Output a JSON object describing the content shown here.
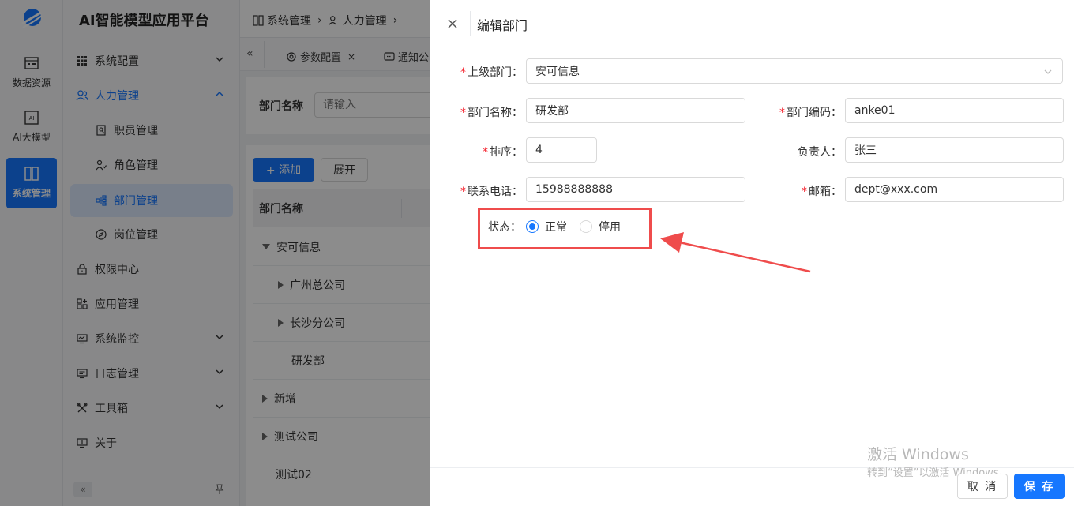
{
  "rail": {
    "items": [
      {
        "label": "数据资源"
      },
      {
        "label": "AI大模型"
      },
      {
        "label": "系统管理"
      }
    ]
  },
  "side": {
    "app_title": "AI智能模型应用平台",
    "menu": [
      {
        "label": "系统配置"
      },
      {
        "label": "人力管理"
      },
      {
        "label": "职员管理"
      },
      {
        "label": "角色管理"
      },
      {
        "label": "部门管理"
      },
      {
        "label": "岗位管理"
      },
      {
        "label": "权限中心"
      },
      {
        "label": "应用管理"
      },
      {
        "label": "系统监控"
      },
      {
        "label": "日志管理"
      },
      {
        "label": "工具箱"
      },
      {
        "label": "关于"
      }
    ]
  },
  "header": {
    "breadcrumb": [
      "系统管理",
      "人力管理"
    ]
  },
  "tabs": [
    "参数配置",
    "通知公"
  ],
  "behind": {
    "search_label": "部门名称",
    "search_placeholder": "请输入",
    "add_button": "+ 添加",
    "expand_button": "展开",
    "column_header": "部门名称",
    "rows": [
      "安可信息",
      "广州总公司",
      "长沙分公司",
      "研发部",
      "新增",
      "测试公司",
      "测试02"
    ]
  },
  "drawer": {
    "title": "编辑部门",
    "fields": {
      "parent_label": "上级部门：",
      "parent_value": "安可信息",
      "name_label": "部门名称：",
      "name_value": "研发部",
      "code_label": "部门编码：",
      "code_value": "anke01",
      "sort_label": "排序：",
      "sort_value": "4",
      "leader_label": "负责人：",
      "leader_value": "张三",
      "phone_label": "联系电话：",
      "phone_value": "15988888888",
      "email_label": "邮箱：",
      "email_value": "dept@xxx.com",
      "status_label": "状态：",
      "status_normal": "正常",
      "status_disabled": "停用",
      "required_mark": "*"
    },
    "cancel_label": "取 消",
    "save_label": "保 存"
  },
  "watermark": {
    "line1": "激活 Windows",
    "line2": "转到“设置”以激活 Windows。"
  },
  "colors": {
    "primary": "#1677ff",
    "annotation": "#ef4c4c"
  }
}
